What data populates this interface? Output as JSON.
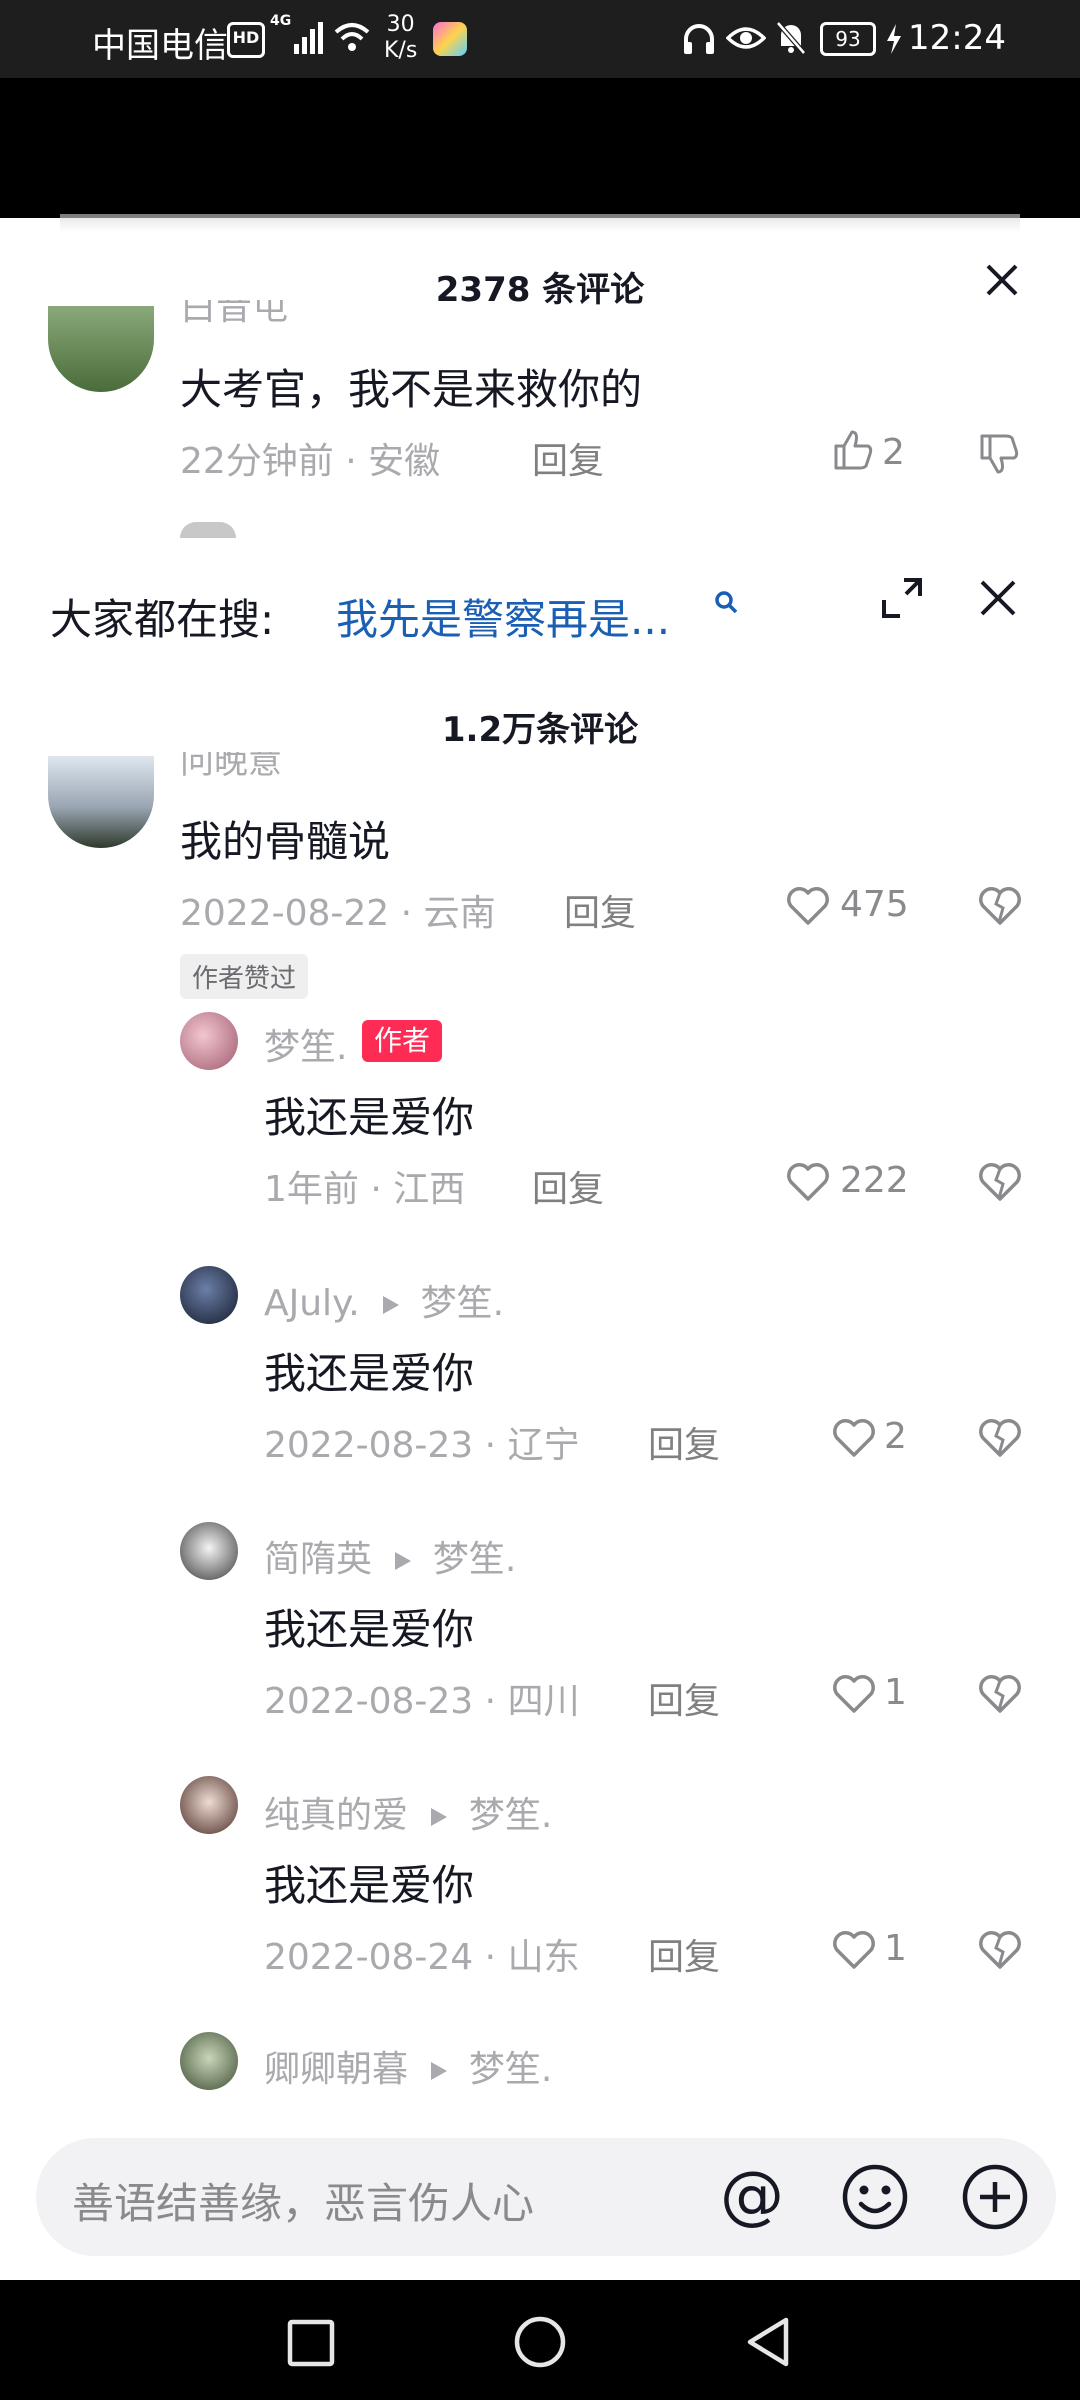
{
  "status_bar": {
    "carrier": "中国电信",
    "hd": "HD",
    "network": "4G",
    "speed_value": "30",
    "speed_unit": "K/s",
    "battery": "93",
    "time": "12:24"
  },
  "top_panel": {
    "title": "2378 条评论",
    "partial_name": "白昔屯",
    "comment": {
      "text": "大考官，我不是来救你的",
      "time": "22分钟前",
      "location": "安徽",
      "reply": "回复",
      "likes": "2"
    }
  },
  "search": {
    "label": "大家都在搜:",
    "term": "我先是警察再是..."
  },
  "main": {
    "title": "1.2万条评论",
    "comment": {
      "partial_name": "问晚意",
      "text": "我的骨髓说",
      "date": "2022-08-22",
      "location": "云南",
      "reply": "回复",
      "likes": "475",
      "badge": "作者赞过"
    },
    "replies": [
      {
        "name": "梦笙.",
        "badge": "作者",
        "text": "我还是爱你",
        "date": "1年前",
        "location": "江西",
        "reply": "回复",
        "likes": "222"
      },
      {
        "name": "AJuly.",
        "to": "梦笙.",
        "text": "我还是爱你",
        "date": "2022-08-23",
        "location": "辽宁",
        "reply": "回复",
        "likes": "2"
      },
      {
        "name": "简隋英",
        "to": "梦笙.",
        "text": "我还是爱你",
        "date": "2022-08-23",
        "location": "四川",
        "reply": "回复",
        "likes": "1"
      },
      {
        "name": "纯真的爱",
        "to": "梦笙.",
        "text": "我还是爱你",
        "date": "2022-08-24",
        "location": "山东",
        "reply": "回复",
        "likes": "1"
      },
      {
        "name": "卿卿朝暮",
        "to": "梦笙."
      }
    ]
  },
  "input": {
    "placeholder": "善语结善缘，恶言伤人心",
    "at": "@"
  },
  "icons": {
    "close": "close-icon",
    "expand": "expand-icon",
    "search": "search-icon",
    "like": "heart-icon",
    "dislike": "broken-heart-icon",
    "emoji": "emoji-icon",
    "add": "add-icon"
  },
  "colors": {
    "accent_red": "#fe2c55",
    "search_term_blue": "#1a5fb4"
  }
}
